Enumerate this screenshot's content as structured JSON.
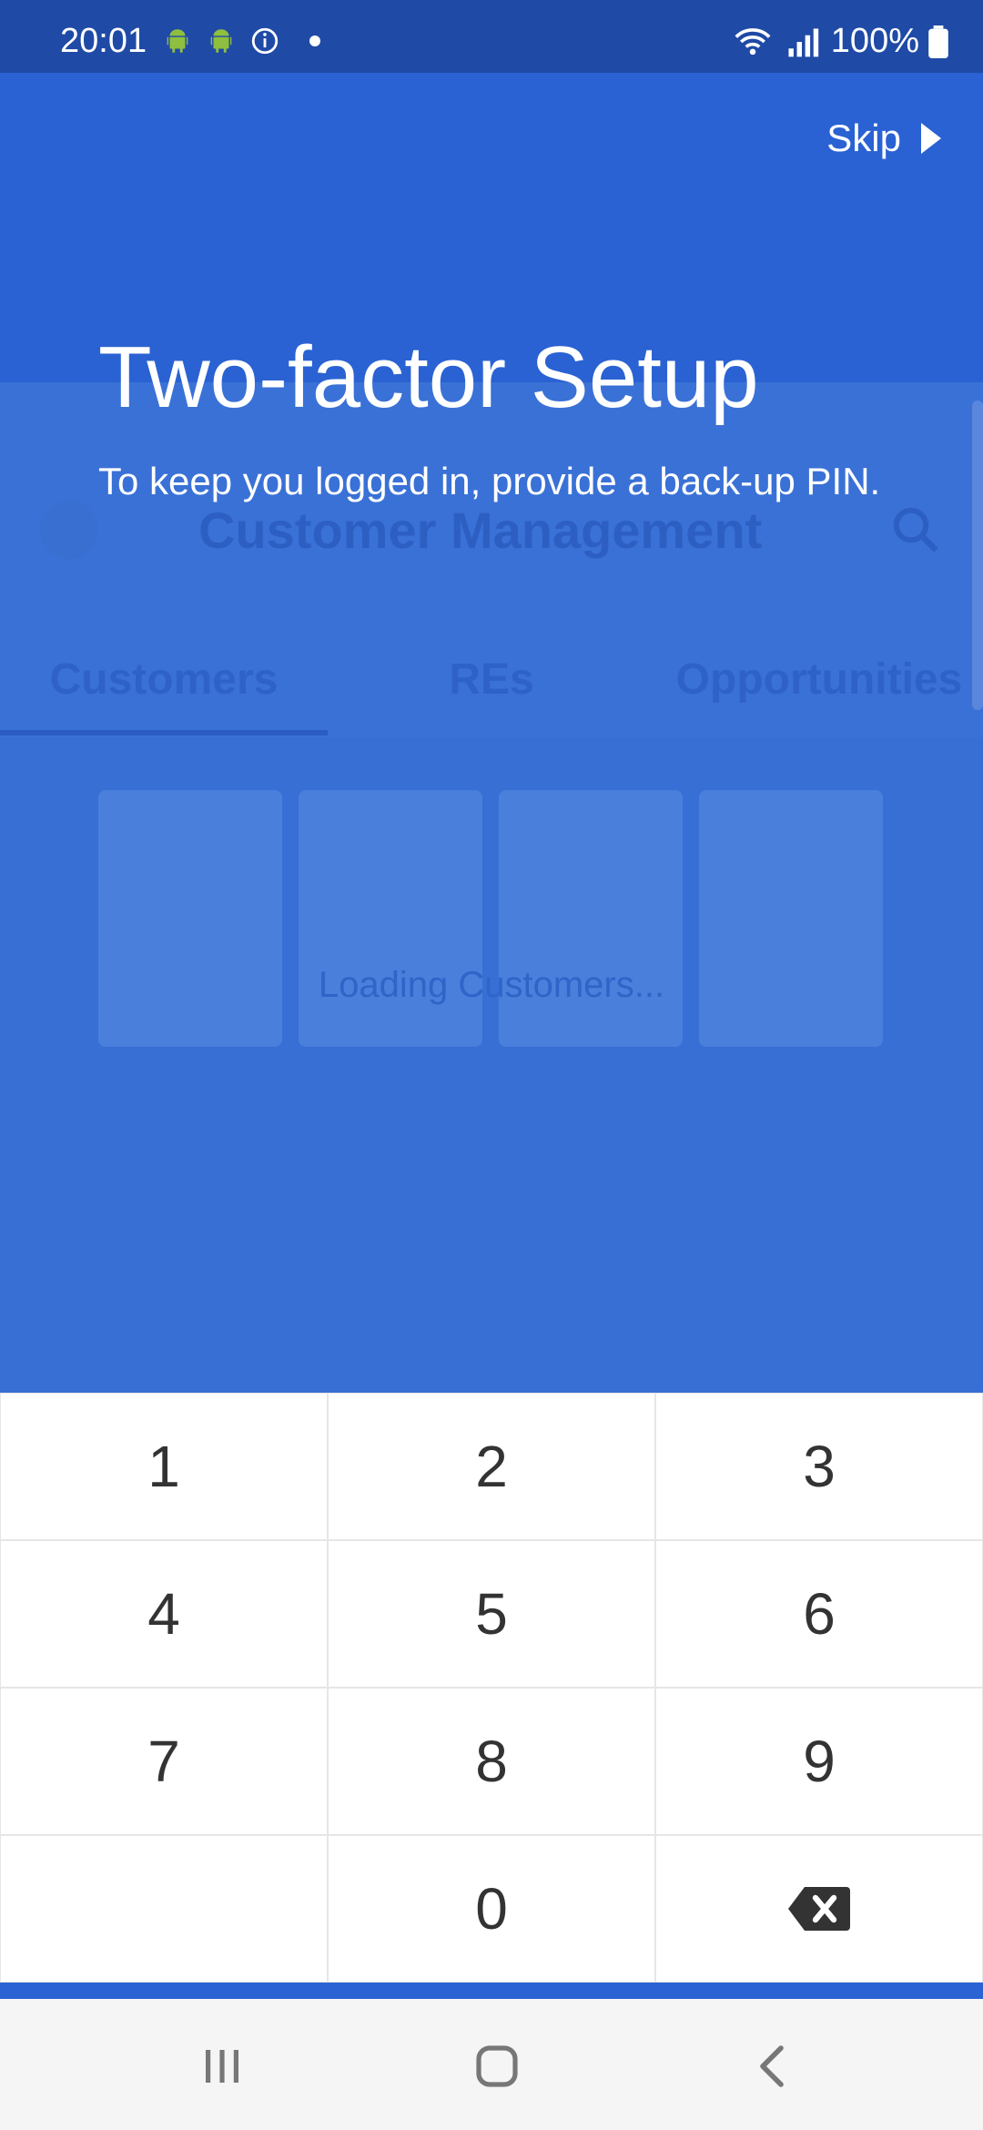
{
  "status_bar": {
    "time": "20:01",
    "battery": "100%",
    "icons": [
      "android-icon",
      "android-icon",
      "info-icon",
      "dot-icon",
      "wifi-icon",
      "signal-icon",
      "battery-icon"
    ]
  },
  "colors": {
    "primary": "#2a62d3",
    "status_bar": "#1f4aa6",
    "keypad_bg": "#ffffff",
    "nav_bar": "#f5f5f5"
  },
  "overlay": {
    "skip_label": "Skip",
    "title": "Two-factor Setup",
    "subtitle": "To keep you logged in, provide a back-up PIN."
  },
  "background_app": {
    "title": "Customer Management",
    "tabs": [
      "Customers",
      "REs",
      "Opportunities"
    ],
    "loading_text": "Loading Customers..."
  },
  "keypad": {
    "keys": [
      "1",
      "2",
      "3",
      "4",
      "5",
      "6",
      "7",
      "8",
      "9",
      "",
      "0",
      "backspace-icon"
    ]
  },
  "nav": {
    "buttons": [
      "recents-icon",
      "home-icon",
      "back-icon"
    ]
  }
}
